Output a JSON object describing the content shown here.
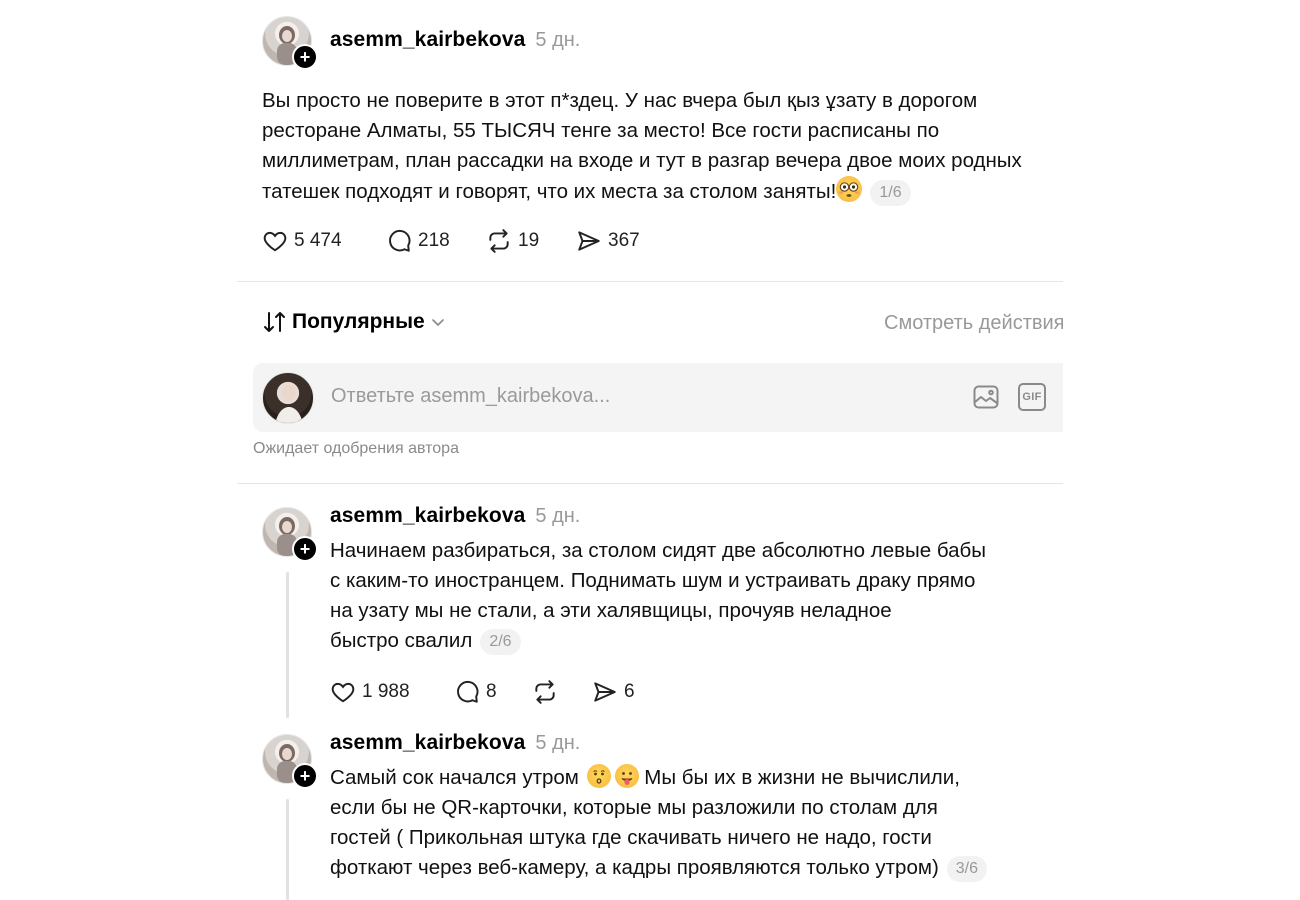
{
  "posts": [
    {
      "username": "asemm_kairbekova",
      "time": "5 дн.",
      "text": "Вы просто не поверите в этот п*здец. У нас вчера был қыз ұзату в дорогом ресторане Алматы, 55 ТЫСЯЧ тенге за место! Все гости расписаны по миллиметрам, план рассадки на входе и тут в разгар вечера двое моих родных татешек подходят и говорят, что их места за столом заняты!",
      "emoji": "😳",
      "counter": "1/6",
      "likes": "5 474",
      "comments": "218",
      "reposts": "19",
      "shares": "367"
    },
    {
      "username": "asemm_kairbekova",
      "time": "5 дн.",
      "text_lines": [
        "Начинаем разбираться, за столом сидят две абсолютно левые бабы",
        "с каким-то иностранцем. Поднимать шум и устраивать драку прямо",
        "на узату мы не стали, а эти халявщицы, прочуяв неладное",
        "быстро свалил"
      ],
      "counter": "2/6",
      "likes": "1 988",
      "comments": "8",
      "shares": "6"
    },
    {
      "username": "asemm_kairbekova",
      "time": "5 дн.",
      "line1_pre": "Самый сок начался утром",
      "emoji1": "😗",
      "emoji2": "😛",
      "line1_post": "Мы бы их в жизни не вычислили,",
      "text_lines": [
        "если бы не QR-карточки, которые мы разложили по столам для",
        "гостей ( Прикольная штука где скачивать ничего не надо, гости",
        "фоткают через веб-камеру, а кадры проявляются только утром)"
      ],
      "counter": "3/6"
    }
  ],
  "sort": {
    "label": "Популярные",
    "view_activity": "Смотреть действия"
  },
  "reply": {
    "placeholder": "Ответьте asemm_kairbekova...",
    "gif_label": "GIF",
    "pending": "Ожидает одобрения автора"
  },
  "icons": {
    "like": "heart-icon",
    "comment": "comment-bubble-icon",
    "repost": "repost-icon",
    "share": "share-icon",
    "sort": "sort-arrows-icon",
    "chevron": "chevron-down-icon",
    "image": "image-icon",
    "gif": "gif-icon",
    "follow": "plus-icon"
  }
}
